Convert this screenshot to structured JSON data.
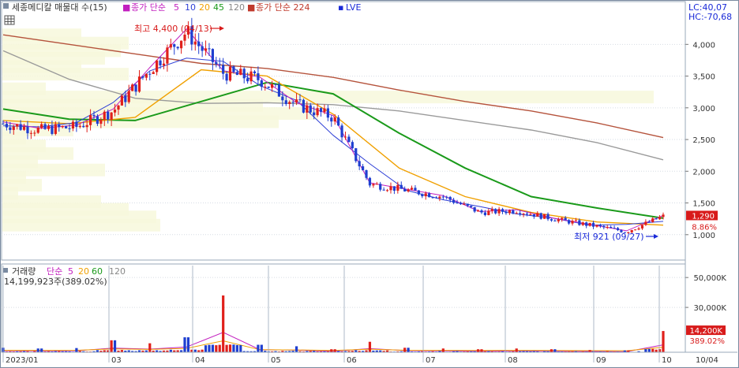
{
  "legend": {
    "name": "세종메디칼 매물대 수(15)",
    "ma_title": "종가 단순",
    "ma_periods": [
      "5",
      "10",
      "20",
      "45",
      "120"
    ],
    "ma_colors": [
      "#c21fbf",
      "#2e3fd6",
      "#f0a000",
      "#1a9a1a",
      "#999999"
    ],
    "ma224_label": "종가 단순 224",
    "ma224_color": "#c0392b",
    "lve_label": "LVE",
    "lve_color": "#1a2ad8"
  },
  "top_right": {
    "lc": "LC:40,07",
    "hc": "HC:-70,68"
  },
  "price_axis": {
    "ticks": [
      "4,000",
      "3,500",
      "3,000",
      "2,500",
      "2,000",
      "1,500",
      "1,000"
    ],
    "ticks_value": [
      4000,
      3500,
      3000,
      2500,
      2000,
      1500,
      1000
    ],
    "min": 600,
    "max": 4650,
    "current_price": "1,290",
    "current_value": 1290,
    "change_pct": "8.86%"
  },
  "annotations": {
    "high": "최고 4,400 (04/13)",
    "low": "최저 921 (09/27)"
  },
  "volume": {
    "title": "거래량",
    "ma_title": "단순",
    "ma_periods": [
      "5",
      "20",
      "60",
      "120"
    ],
    "ma_colors": [
      "#c21fbf",
      "#f0a000",
      "#1a9a1a",
      "#999999"
    ],
    "summary": "14,199,923주(389.02%)",
    "axis_ticks": [
      "50,000K",
      "30,000K"
    ],
    "axis_values": [
      50000,
      30000
    ],
    "current_label": "14,200K",
    "current_value": 14200,
    "ratio_label": "389.02%",
    "max": 58000
  },
  "x_axis": {
    "labels": [
      "2023/01",
      "03",
      "04",
      "05",
      "06",
      "07",
      "08",
      "09",
      "10",
      "10/04"
    ]
  },
  "chart_data": {
    "type": "candlestick",
    "series": [
      {
        "name": "종가 단순 224",
        "values": [
          4150,
          4000,
          3850,
          3700,
          3620,
          3480,
          3280,
          3100,
          2950,
          2760,
          2530
        ]
      },
      {
        "name": "120",
        "values": [
          3900,
          3450,
          3150,
          3070,
          3080,
          3050,
          2950,
          2800,
          2650,
          2450,
          2180
        ]
      },
      {
        "name": "45",
        "values": [
          2980,
          2820,
          2800,
          3100,
          3400,
          3220,
          2600,
          2050,
          1600,
          1420,
          1260
        ]
      },
      {
        "name": "20",
        "values": [
          2800,
          2750,
          2850,
          3600,
          3500,
          2900,
          2050,
          1600,
          1350,
          1200,
          1150
        ]
      }
    ],
    "candles_close": [
      2750,
      2650,
      2700,
      2950,
      3600,
      4200,
      3550,
      3450,
      3050,
      2850,
      1800,
      1700,
      1600,
      1350,
      1380,
      1250,
      1150,
      1050,
      1290
    ],
    "volume_bars_k": [
      3000,
      2500,
      2800,
      8000,
      6000,
      10000,
      38000,
      5000,
      4000,
      2000,
      7000,
      3000,
      2500,
      2000,
      2500,
      2000,
      1500,
      1200,
      14200
    ],
    "price_range": [
      600,
      4650
    ],
    "volume_range": [
      0,
      58000
    ]
  }
}
